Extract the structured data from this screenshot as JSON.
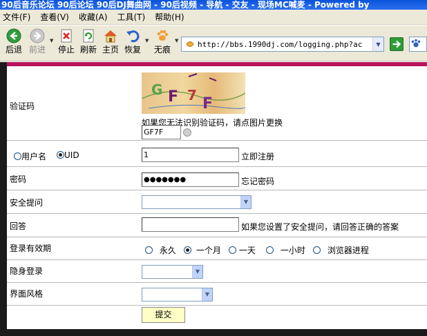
{
  "window": {
    "title": "90后音乐论坛 90后论坛 90后DJ舞曲网 - 90后视频 - 导航 - 交友 - 现场MC喊麦 - Powered by"
  },
  "menu": [
    "文件(F)",
    "查看(V)",
    "收藏(A)",
    "工具(T)",
    "帮助(H)"
  ],
  "toolbar": {
    "back": "后退",
    "forward": "前进",
    "stop": "停止",
    "refresh": "刷新",
    "home": "主页",
    "restore": "恢复",
    "private": "无痕"
  },
  "address": {
    "url": "http://bbs.1990dj.com/logging.php?ac"
  },
  "form": {
    "captcha_label": "验证码",
    "captcha_hint": "如果您无法识别验证码，请点图片更换",
    "captcha_value": "GF7F",
    "captcha_image_text": "GF7F",
    "login_type": {
      "username": "用户名",
      "uid": "UID",
      "selected": "UID"
    },
    "uid_value": "1",
    "register_link": "立即注册",
    "password_label": "密码",
    "password_value": "●●●●●●●",
    "forgot_link": "忘记密码",
    "security_question_label": "安全提问",
    "answer_label": "回答",
    "answer_hint": "如果您设置了安全提问，请回答正确的答案",
    "validity_label": "登录有效期",
    "validity_options": [
      "永久",
      "一个月",
      "一天",
      "一小时",
      "浏览器进程"
    ],
    "validity_selected": "一个月",
    "invisible_label": "隐身登录",
    "style_label": "界面风格",
    "submit": "提交"
  },
  "colors": {
    "accent_line": "#b8135c",
    "submit_bg": "#ffffc6",
    "page_bg": "#1b1b1b"
  }
}
